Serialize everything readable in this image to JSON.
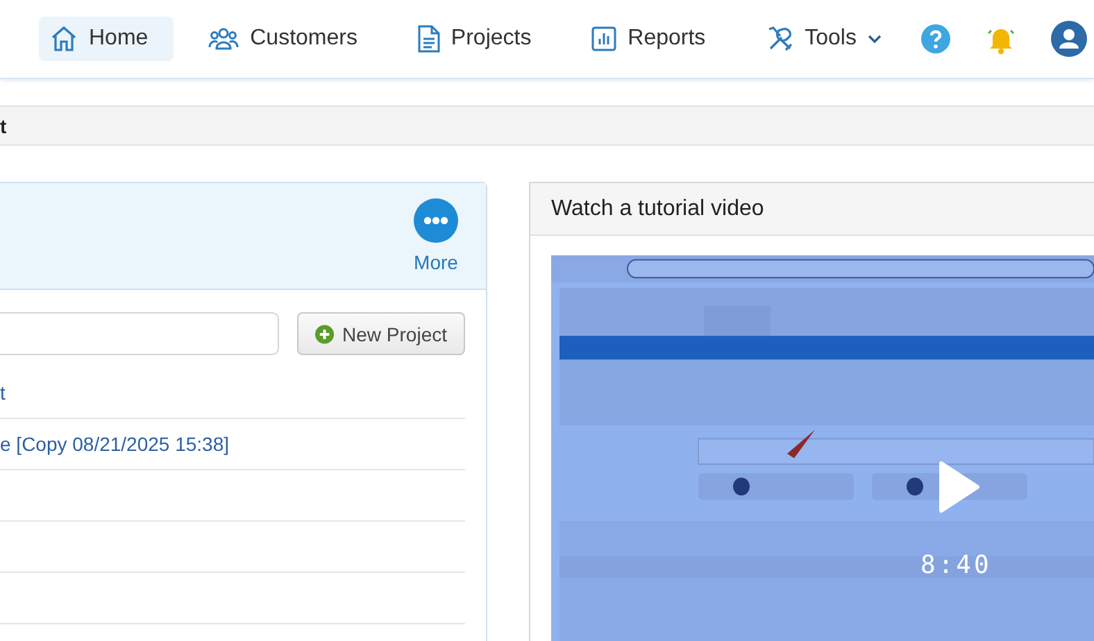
{
  "nav": {
    "items": [
      {
        "label": "Home",
        "selected": true
      },
      {
        "label": "Customers",
        "selected": false
      },
      {
        "label": "Projects",
        "selected": false
      },
      {
        "label": "Reports",
        "selected": false
      },
      {
        "label": "Tools",
        "selected": false,
        "dropdown": true
      }
    ]
  },
  "breadcrumb": "t",
  "projects_panel": {
    "more_label": "More",
    "new_project_label": "New Project",
    "rows": [
      "t",
      "e [Copy 08/21/2025 15:38]",
      "",
      "",
      "",
      ""
    ]
  },
  "video_panel": {
    "title": "Watch a tutorial video",
    "video": {
      "kind": "picture",
      "duration": "8:40"
    }
  }
}
